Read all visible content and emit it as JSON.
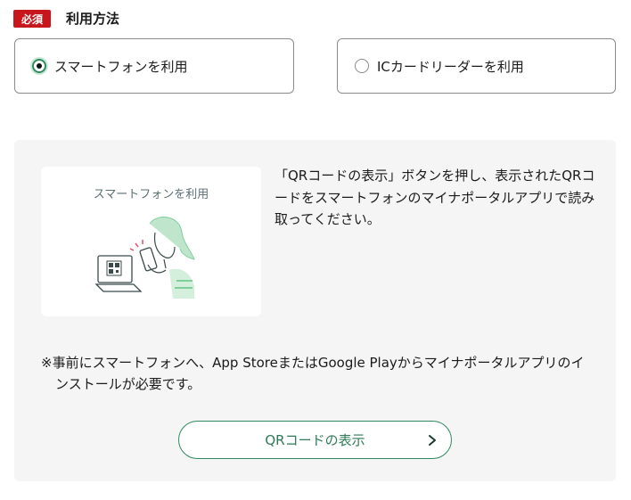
{
  "header": {
    "required_badge": "必須",
    "title": "利用方法"
  },
  "options": [
    {
      "label": "スマートフォンを利用",
      "selected": true
    },
    {
      "label": "ICカードリーダーを利用",
      "selected": false
    }
  ],
  "panel": {
    "illustration_caption": "スマートフォンを利用",
    "instruction": "「QRコードの表示」ボタンを押し、表示されたQRコードをスマートフォンのマイナポータルアプリで読み取ってください。",
    "note": "※事前にスマートフォンへ、App StoreまたはGoogle Playからマイナポータルアプリのインストールが必要です。",
    "button_label": "QRコードの表示",
    "button_icon": "chevron-right-icon"
  },
  "colors": {
    "required_badge": "#c8161d",
    "accent_green": "#2f8a5f",
    "panel_bg": "#f5f5f5"
  }
}
